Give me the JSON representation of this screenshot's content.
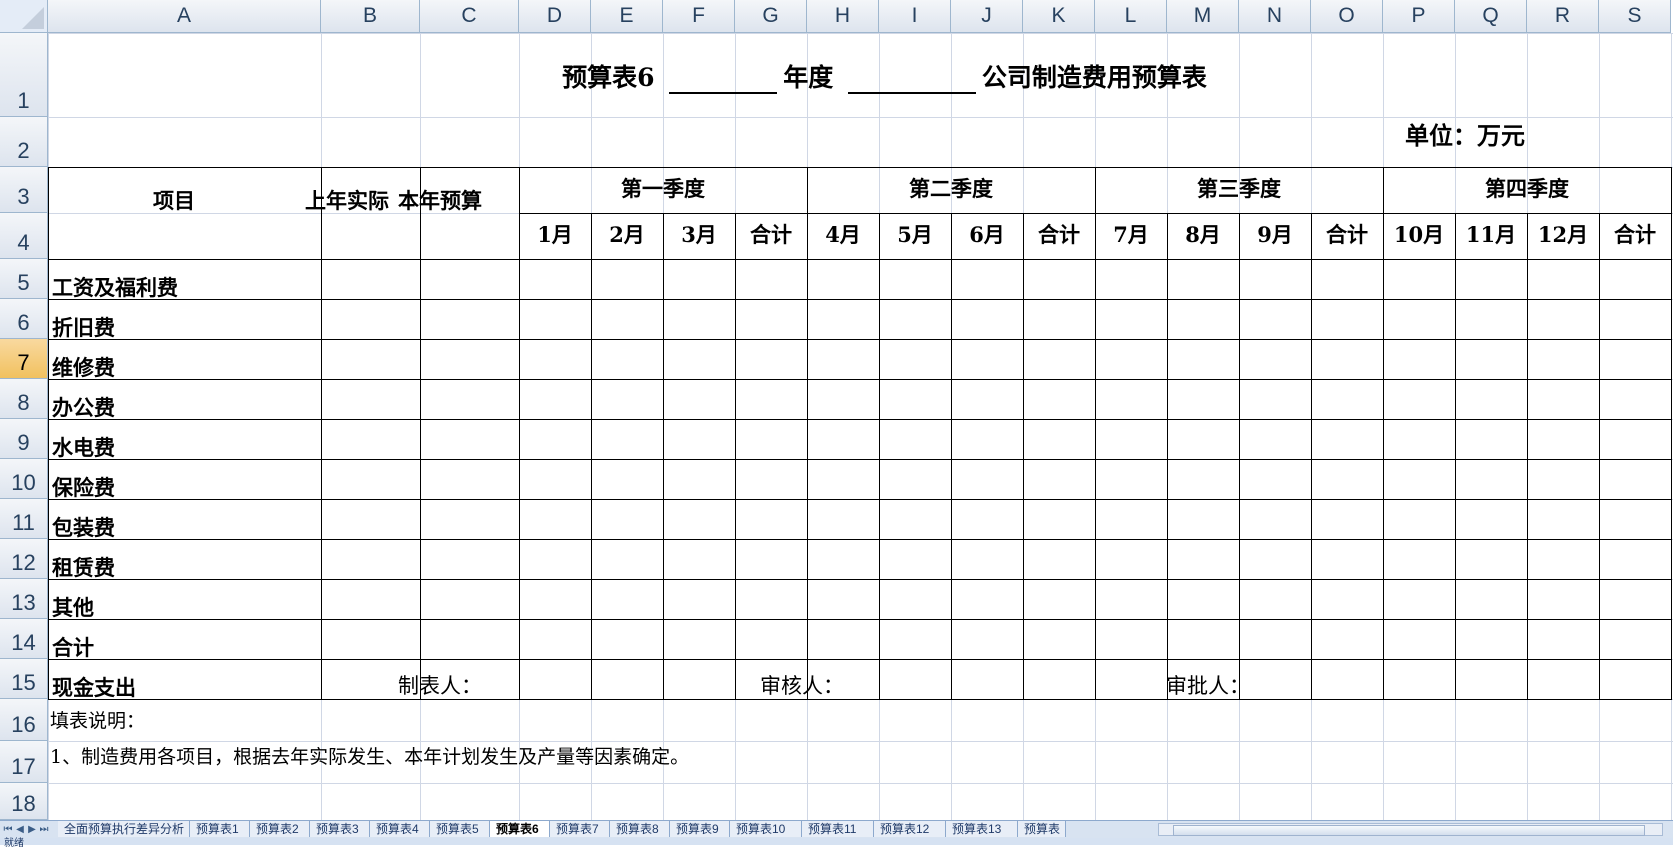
{
  "columns": [
    "A",
    "B",
    "C",
    "D",
    "E",
    "F",
    "G",
    "H",
    "I",
    "J",
    "K",
    "L",
    "M",
    "N",
    "O",
    "P",
    "Q",
    "R",
    "S"
  ],
  "rows": [
    "1",
    "2",
    "3",
    "4",
    "5",
    "6",
    "7",
    "8",
    "9",
    "10",
    "11",
    "12",
    "13",
    "14",
    "15",
    "16",
    "17",
    "18"
  ],
  "selected_row": "7",
  "title": {
    "prefix": "预算表6",
    "mid": "年度",
    "suffix": "公司制造费用预算表"
  },
  "unit": "单位：万元",
  "header": {
    "item": "项目",
    "last_year": "上年实际",
    "this_year": "本年预算",
    "quarters": [
      "第一季度",
      "第二季度",
      "第三季度",
      "第四季度"
    ],
    "months": [
      "1月",
      "2月",
      "3月",
      "合计",
      "4月",
      "5月",
      "6月",
      "合计",
      "7月",
      "8月",
      "9月",
      "合计",
      "10月",
      "11月",
      "12月",
      "合计"
    ]
  },
  "items": [
    "工资及福利费",
    "折旧费",
    "维修费",
    "办公费",
    "水电费",
    "保险费",
    "包装费",
    "租赁费",
    "其他",
    "合计",
    "现金支出"
  ],
  "signatures": {
    "preparer": "制表人：",
    "reviewer": "审核人：",
    "approver": "审批人："
  },
  "notes": {
    "heading": "填表说明：",
    "line1": "1、制造费用各项目，根据去年实际发生、本年计划发生及产量等因素确定。"
  },
  "sheet_tabs": [
    "全面预算执行差异分析",
    "预算表1",
    "预算表2",
    "预算表3",
    "预算表4",
    "预算表5",
    "预算表6",
    "预算表7",
    "预算表8",
    "预算表9",
    "预算表10",
    "预算表11",
    "预算表12",
    "预算表13",
    "预算表"
  ],
  "active_tab": "预算表6",
  "status": "就绪"
}
